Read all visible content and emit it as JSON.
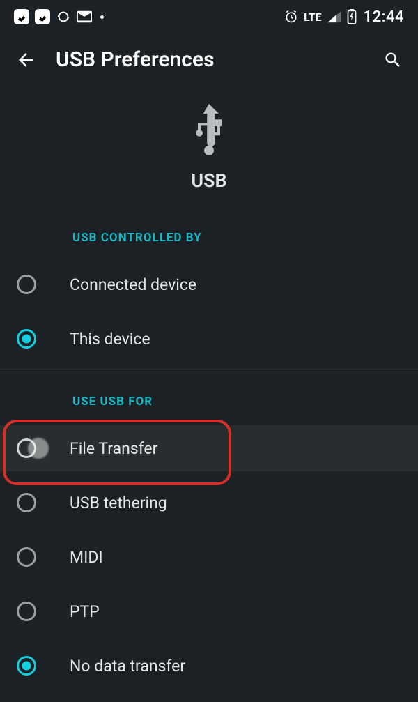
{
  "status_bar": {
    "network": "LTE",
    "time": "12:44"
  },
  "header": {
    "title": "USB Preferences"
  },
  "hero": {
    "label": "USB"
  },
  "section_controlled_by": {
    "label": "USB CONTROLLED BY",
    "options": {
      "connected_device": "Connected device",
      "this_device": "This device"
    },
    "selected": "this_device"
  },
  "section_use_for": {
    "label": "USE USB FOR",
    "options": {
      "file_transfer": "File Transfer",
      "usb_tethering": "USB tethering",
      "midi": "MIDI",
      "ptp": "PTP",
      "no_data_transfer": "No data transfer"
    },
    "selected": "no_data_transfer",
    "highlighted": "file_transfer"
  }
}
